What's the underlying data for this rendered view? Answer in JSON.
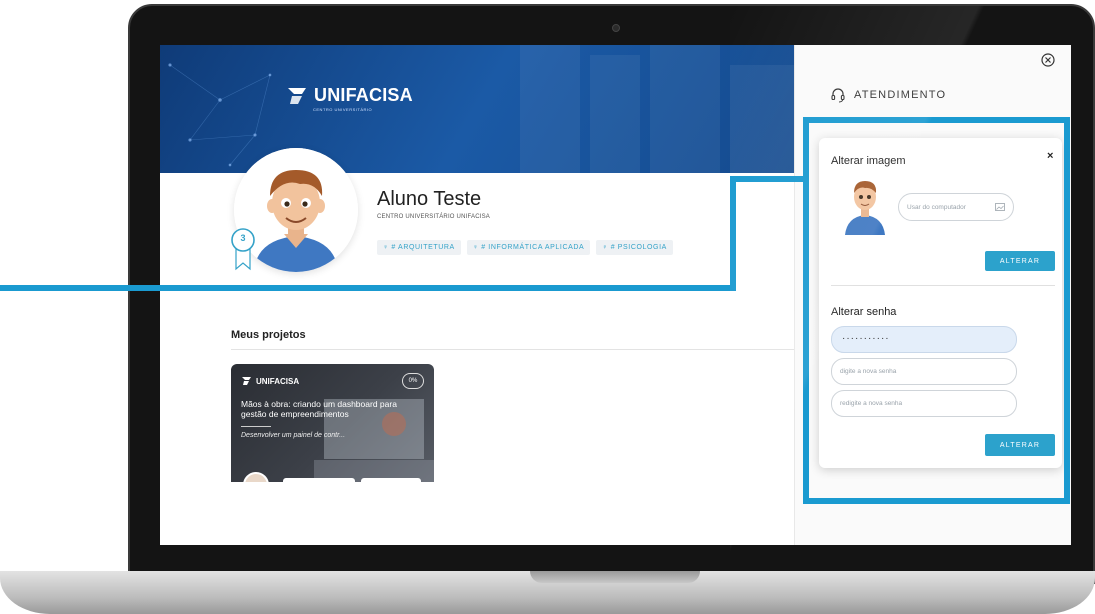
{
  "profile": {
    "logo_text": "UNIFACISA",
    "logo_sub": "CENTRO UNIVERSITÁRIO",
    "name": "Aluno Teste",
    "institution": "CENTRO UNIVERSITÁRIO UNIFACISA",
    "level": "3",
    "tags": [
      "# ARQUITETURA",
      "# INFORMÁTICA APLICADA",
      "# PSICOLOGIA"
    ]
  },
  "projects": {
    "title": "Meus projetos",
    "card": {
      "logo": "UNIFACISA",
      "progress": "0%",
      "title": "Mãos à obra: criando um dashboard para gestão de empreendimentos",
      "description": "Desenvolver um painel de contr..."
    }
  },
  "side_panel": {
    "header": "ATENDIMENTO",
    "modal": {
      "image_heading": "Alterar imagem",
      "file_placeholder": "Usar do computador",
      "image_button": "ALTERAR",
      "password_heading": "Alterar senha",
      "current_password": "···········",
      "new_password_placeholder": "digite a nova senha",
      "repeat_password_placeholder": "redigite a nova senha",
      "password_button": "ALTERAR"
    }
  },
  "colors": {
    "accent": "#2ca2cc",
    "highlight": "#1a9ad0",
    "banner": "#1b5aa6"
  }
}
